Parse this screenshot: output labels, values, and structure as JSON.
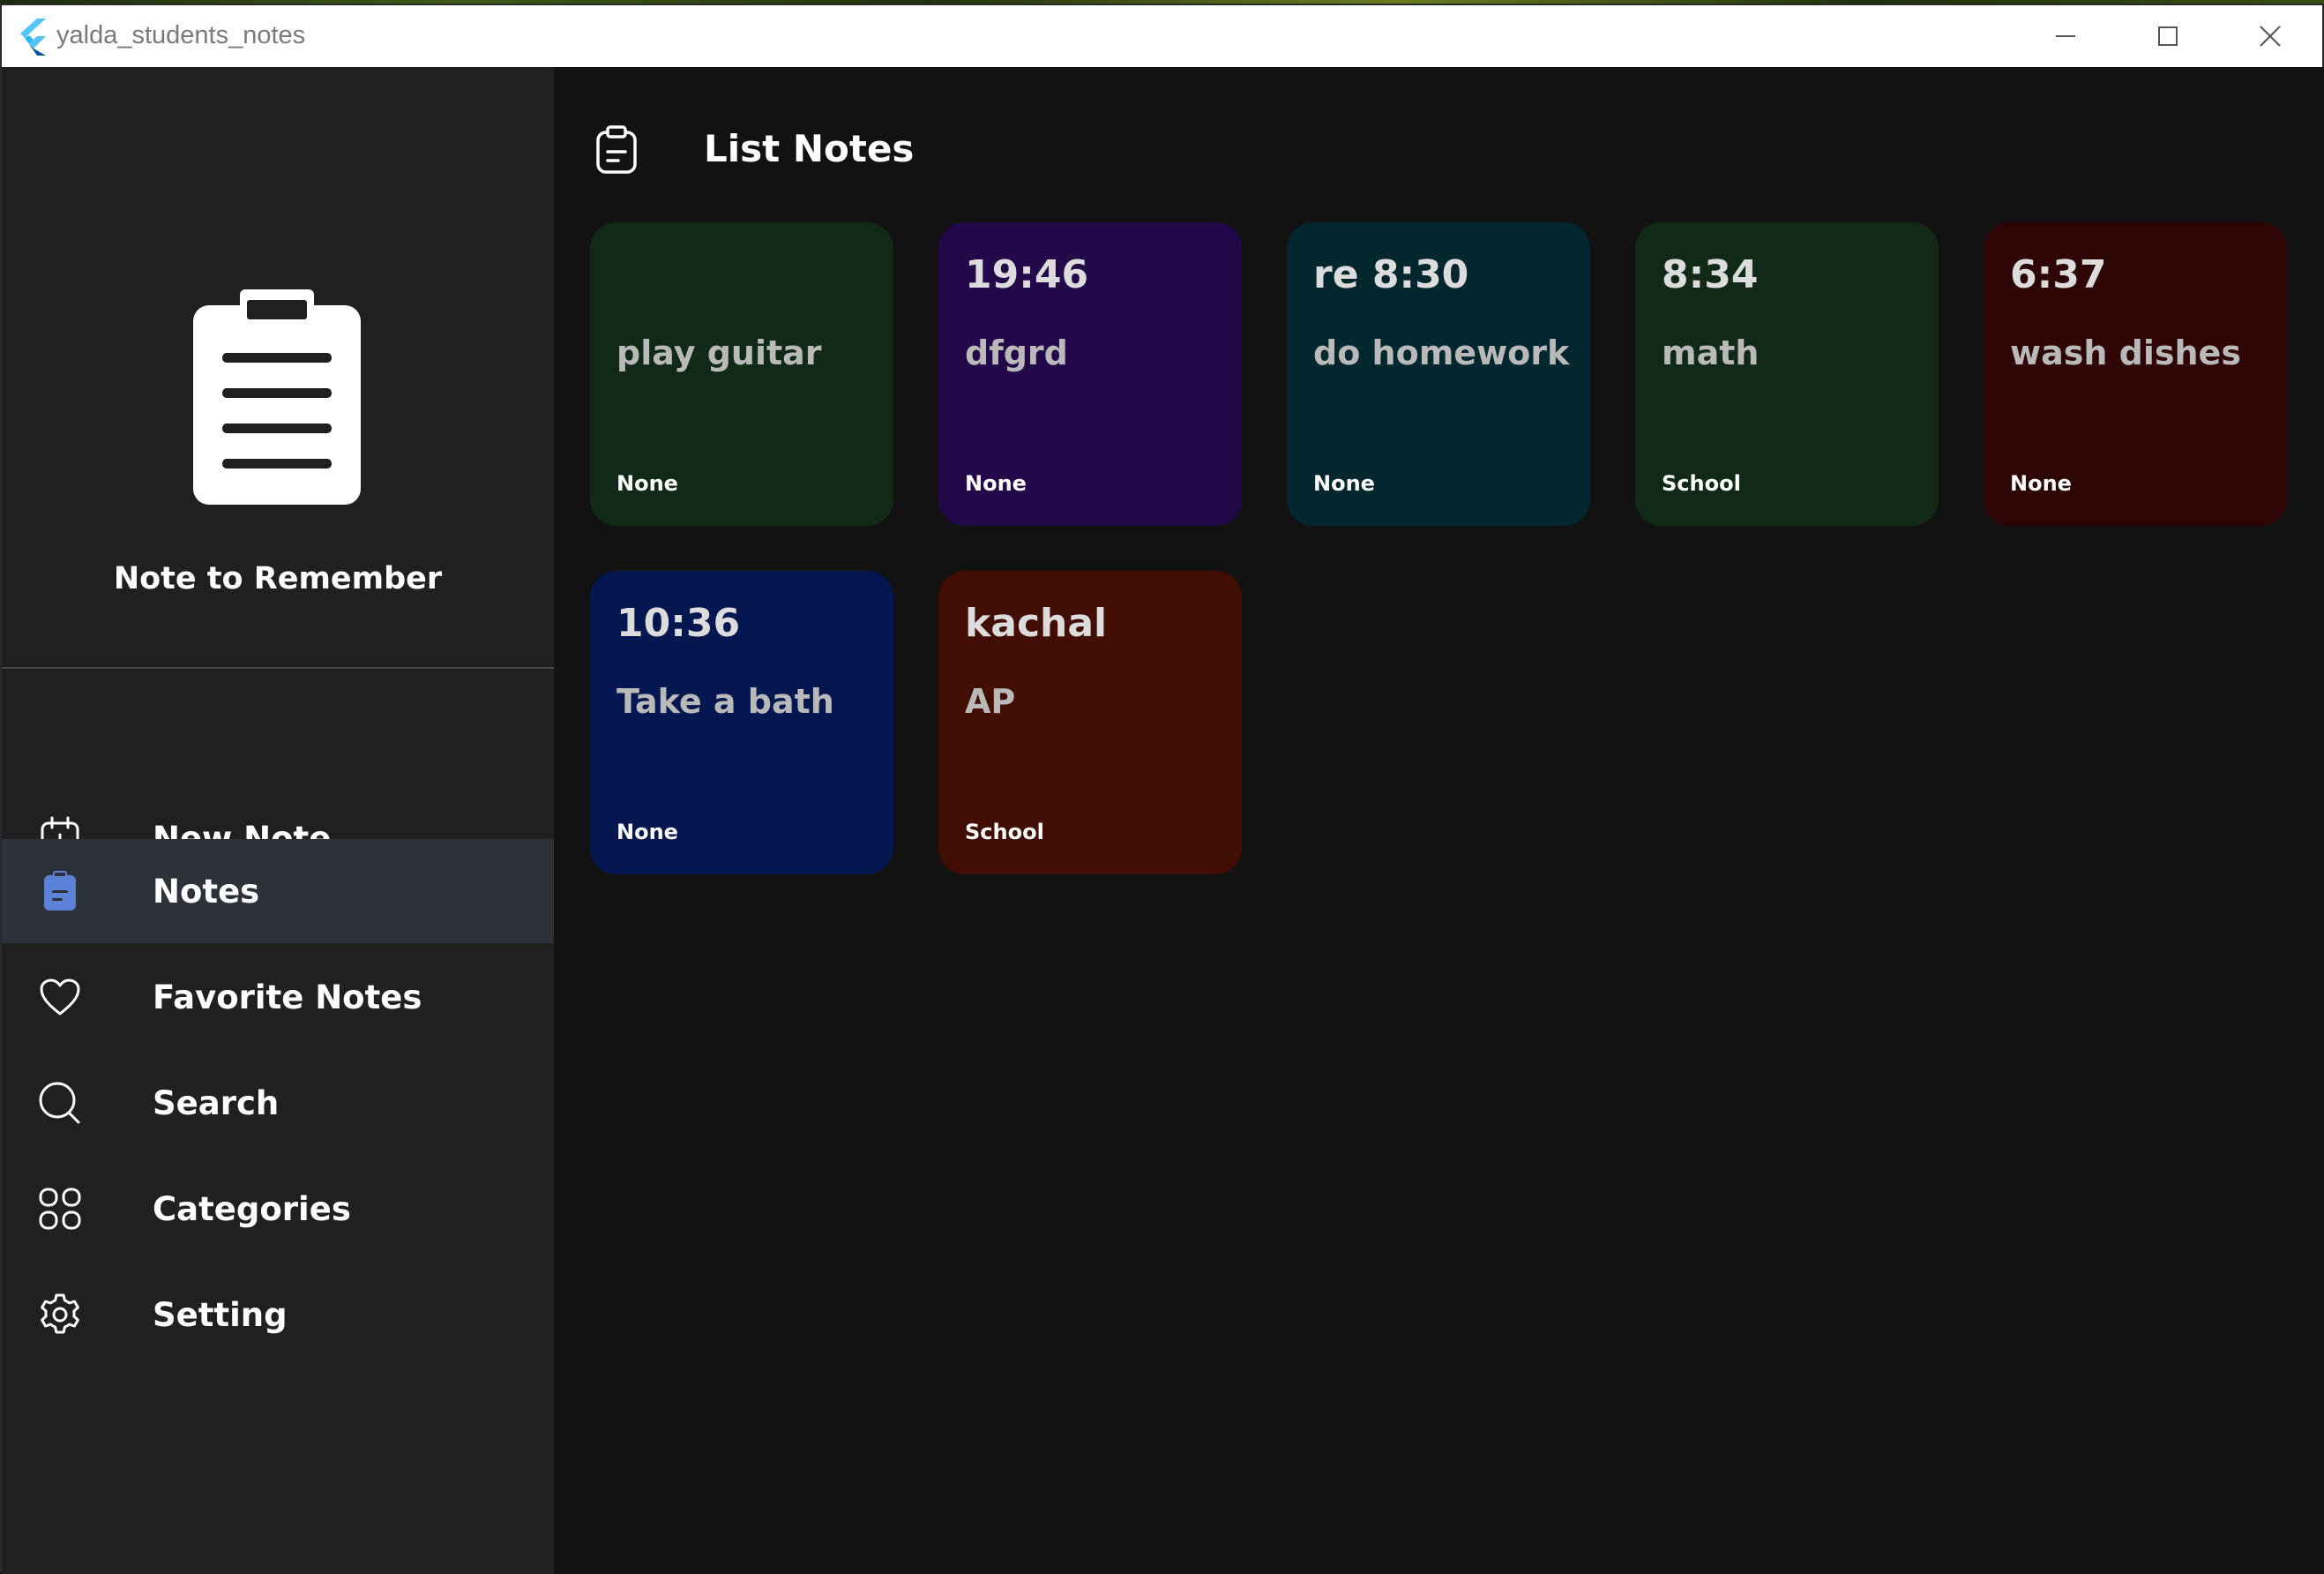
{
  "window": {
    "title": "yalda_students_notes"
  },
  "sidebar": {
    "app_name": "Note to Remember",
    "items": [
      {
        "label": "New Note",
        "icon": "calendar-plus-icon",
        "active": false
      },
      {
        "label": "Notes",
        "icon": "clipboard-icon",
        "active": true
      },
      {
        "label": "Favorite Notes",
        "icon": "heart-icon",
        "active": false
      },
      {
        "label": "Search",
        "icon": "search-icon",
        "active": false
      },
      {
        "label": "Categories",
        "icon": "grid-icon",
        "active": false
      },
      {
        "label": "Setting",
        "icon": "gear-icon",
        "active": false
      }
    ]
  },
  "main": {
    "title": "List Notes",
    "notes": [
      {
        "time": "",
        "title": "play guitar",
        "category": "None",
        "color": "#112a18"
      },
      {
        "time": "19:46",
        "title": "dfgrd",
        "category": "None",
        "color": "#23084a"
      },
      {
        "time": "re 8:30",
        "title": "do homework",
        "category": "None",
        "color": "#03272f"
      },
      {
        "time": "8:34",
        "title": "math",
        "category": "School",
        "color": "#112a18"
      },
      {
        "time": "6:37",
        "title": "wash dishes",
        "category": "None",
        "color": "#2f0404"
      },
      {
        "time": "10:36",
        "title": "Take a bath",
        "category": "None",
        "color": "#041750"
      },
      {
        "time": "kachal",
        "title": "AP",
        "category": "School",
        "color": "#420e04"
      }
    ]
  },
  "colors": {
    "accent": "#5b82d6",
    "sidebar_bg": "#202020",
    "main_bg": "#121212",
    "active_bg": "#2d313a"
  }
}
